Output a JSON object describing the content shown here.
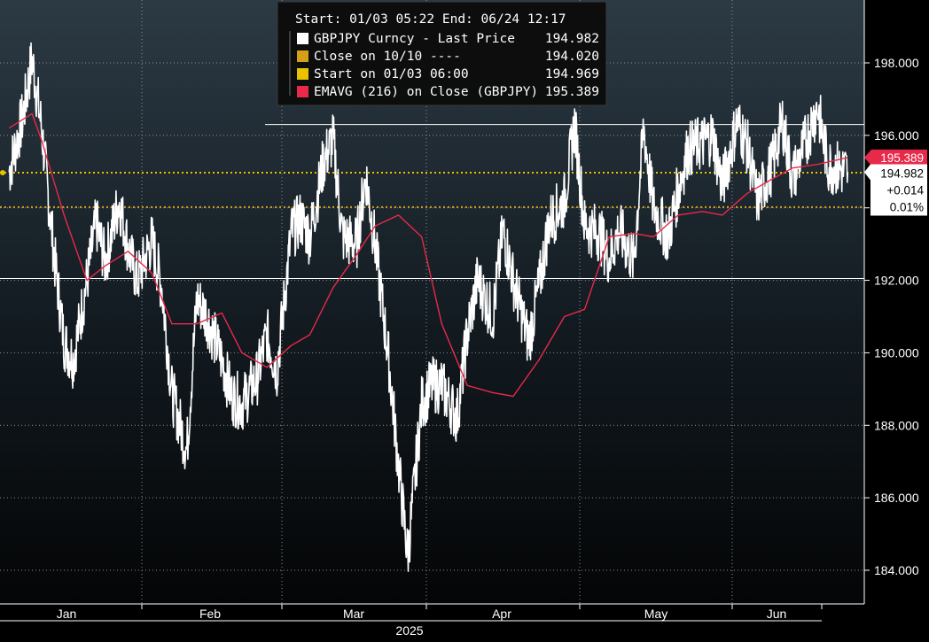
{
  "chart_data": {
    "type": "line",
    "title": "",
    "xlabel": "2025",
    "ylabel": "",
    "ylim": [
      183.2,
      200.0
    ],
    "grid": true,
    "yticks": [
      "184.000",
      "186.000",
      "188.000",
      "190.000",
      "192.000",
      "194.000",
      "196.000",
      "198.000"
    ],
    "ytick_values": [
      184,
      186,
      188,
      190,
      192,
      194,
      196,
      198
    ],
    "months": [
      "Jan",
      "Feb",
      "Mar",
      "Apr",
      "May",
      "Jun"
    ],
    "year": "2025",
    "legend": {
      "header": "Start: 01/03 05:22 End: 06/24 12:17",
      "entries": [
        {
          "label": "GBPJPY Curncy - Last Price",
          "value": "194.982",
          "color": "#ffffff"
        },
        {
          "label": "Close on 10/10 ----",
          "value": "194.020",
          "color": "#d4a017"
        },
        {
          "label": "Start on 01/03 06:00",
          "value": "194.969",
          "color": "#e8c200"
        },
        {
          "label": "EMAVG (216)  on Close (GBPJPY)",
          "value": "195.389",
          "color": "#e8294a"
        }
      ]
    },
    "series": [
      {
        "name": "GBPJPY Curncy - Last Price",
        "color": "#ffffff",
        "x": [
          "01/03",
          "01/06",
          "01/08",
          "01/10",
          "01/13",
          "01/15",
          "01/17",
          "01/20",
          "01/22",
          "01/24",
          "01/27",
          "01/29",
          "01/31",
          "02/03",
          "02/05",
          "02/07",
          "02/10",
          "02/12",
          "02/14",
          "02/17",
          "02/19",
          "02/21",
          "02/24",
          "02/26",
          "02/28",
          "03/03",
          "03/05",
          "03/07",
          "03/10",
          "03/12",
          "03/14",
          "03/17",
          "03/19",
          "03/21",
          "03/24",
          "03/26",
          "03/28",
          "03/31",
          "04/02",
          "04/04",
          "04/07",
          "04/09",
          "04/11",
          "04/14",
          "04/16",
          "04/18",
          "04/21",
          "04/23",
          "04/25",
          "04/28",
          "04/30",
          "05/02",
          "05/05",
          "05/07",
          "05/09",
          "05/12",
          "05/14",
          "05/16",
          "05/19",
          "05/21",
          "05/23",
          "05/26",
          "05/28",
          "05/30",
          "06/02",
          "06/04",
          "06/06",
          "06/09",
          "06/11",
          "06/13",
          "06/16",
          "06/18",
          "06/20",
          "06/24"
        ],
        "values": [
          195.0,
          196.5,
          198.1,
          196.3,
          192.5,
          190.3,
          189.8,
          192.0,
          193.6,
          192.5,
          194.2,
          192.9,
          192.0,
          193.1,
          191.8,
          188.9,
          187.3,
          191.5,
          191.0,
          189.8,
          188.8,
          188.6,
          189.3,
          190.5,
          189.5,
          193.3,
          193.7,
          193.2,
          195.3,
          195.9,
          193.2,
          193.0,
          194.9,
          193.0,
          189.7,
          186.9,
          184.4,
          188.6,
          189.1,
          189.1,
          188.2,
          190.5,
          192.0,
          191.0,
          193.4,
          192.0,
          190.3,
          191.8,
          193.6,
          194.2,
          196.3,
          193.5,
          193.3,
          192.6,
          193.4,
          192.5,
          196.2,
          194.0,
          193.2,
          194.5,
          195.6,
          195.8,
          196.0,
          194.6,
          196.4,
          195.7,
          194.2,
          195.2,
          196.4,
          194.8,
          196.0,
          196.8,
          195.2,
          194.982
        ]
      },
      {
        "name": "EMAVG (216)  on Close (GBPJPY)",
        "color": "#e8294a",
        "x": [
          "01/03",
          "01/08",
          "01/10",
          "01/15",
          "01/20",
          "01/24",
          "01/29",
          "02/03",
          "02/07",
          "02/12",
          "02/17",
          "02/21",
          "02/26",
          "03/03",
          "03/07",
          "03/12",
          "03/17",
          "03/21",
          "03/26",
          "03/31",
          "04/04",
          "04/09",
          "04/14",
          "04/18",
          "04/23",
          "04/28",
          "05/02",
          "05/07",
          "05/12",
          "05/16",
          "05/21",
          "05/26",
          "05/30",
          "06/04",
          "06/09",
          "06/13",
          "06/18",
          "06/24"
        ],
        "values": [
          196.2,
          196.6,
          195.9,
          193.8,
          192.0,
          192.4,
          192.8,
          192.2,
          190.8,
          190.8,
          191.1,
          190.0,
          189.6,
          190.2,
          190.5,
          191.8,
          192.7,
          193.5,
          193.8,
          193.2,
          190.8,
          189.1,
          188.9,
          188.8,
          189.8,
          191.0,
          191.2,
          193.2,
          193.3,
          193.2,
          193.8,
          193.9,
          193.8,
          194.4,
          194.8,
          195.1,
          195.2,
          195.389
        ]
      }
    ],
    "reference_lines": [
      {
        "name": "Close on 10/10",
        "value": 194.02,
        "color": "#d4a017"
      },
      {
        "name": "Start on 01/03 06:00",
        "value": 194.969,
        "color": "#e8c200"
      }
    ],
    "other_lines": [
      196.3,
      192.05
    ],
    "tags": {
      "ema": {
        "value": "195.389",
        "color": "#e8294a"
      },
      "last": {
        "value": "194.982",
        "change": "+0.014",
        "pct": "0.01%"
      }
    }
  }
}
